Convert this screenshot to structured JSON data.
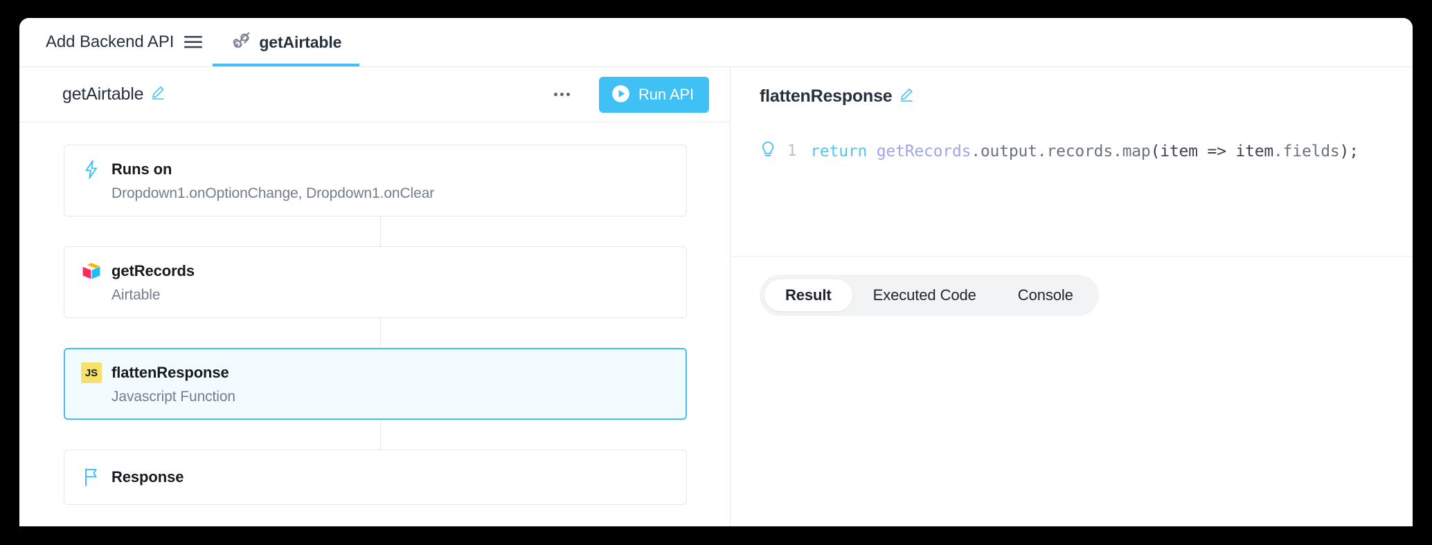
{
  "window": {
    "tabbar": {
      "add_backend_api_label": "Add Backend API",
      "menu_icon": "hamburger-icon",
      "api_tab": {
        "icon": "plug-connector-icon",
        "label": "getAirtable",
        "active": true
      }
    }
  },
  "left_panel": {
    "header": {
      "title": "getAirtable",
      "edit_icon": "pencil-icon",
      "more_icon": "ellipsis-icon",
      "run_button": {
        "label": "Run API",
        "icon": "play-circle-icon",
        "color": "#3fc1f5"
      }
    },
    "flow": {
      "nodes": [
        {
          "icon": "lightning-bolt-icon",
          "title": "Runs on",
          "subtitle": "Dropdown1.onOptionChange, Dropdown1.onClear",
          "selected": false,
          "type": "trigger"
        },
        {
          "icon": "airtable-logo-icon",
          "title": "getRecords",
          "subtitle": "Airtable",
          "selected": false,
          "type": "query"
        },
        {
          "icon": "js-badge-icon",
          "title": "flattenResponse",
          "subtitle": "Javascript Function",
          "selected": true,
          "type": "js-function"
        },
        {
          "icon": "flag-icon",
          "title": "Response",
          "subtitle": "",
          "selected": false,
          "type": "response"
        }
      ]
    }
  },
  "right_panel": {
    "header": {
      "title": "flattenResponse",
      "edit_icon": "pencil-icon"
    },
    "editor": {
      "gutter_icon": "lightbulb-icon",
      "line_number": "1",
      "tokens": [
        {
          "text": "return ",
          "kind": "keyword"
        },
        {
          "text": "getRecords",
          "kind": "reference"
        },
        {
          "text": ".output",
          "kind": "property"
        },
        {
          "text": ".records",
          "kind": "property"
        },
        {
          "text": ".map",
          "kind": "property"
        },
        {
          "text": "(",
          "kind": "punctuation"
        },
        {
          "text": "item",
          "kind": "identifier"
        },
        {
          "text": " => ",
          "kind": "punctuation"
        },
        {
          "text": "item",
          "kind": "identifier"
        },
        {
          "text": ".fields",
          "kind": "property"
        },
        {
          "text": ");",
          "kind": "punctuation"
        }
      ],
      "full_code": "return getRecords.output.records.map(item => item.fields);"
    },
    "tabs": [
      {
        "label": "Result",
        "active": true
      },
      {
        "label": "Executed Code",
        "active": false
      },
      {
        "label": "Console",
        "active": false
      }
    ]
  }
}
